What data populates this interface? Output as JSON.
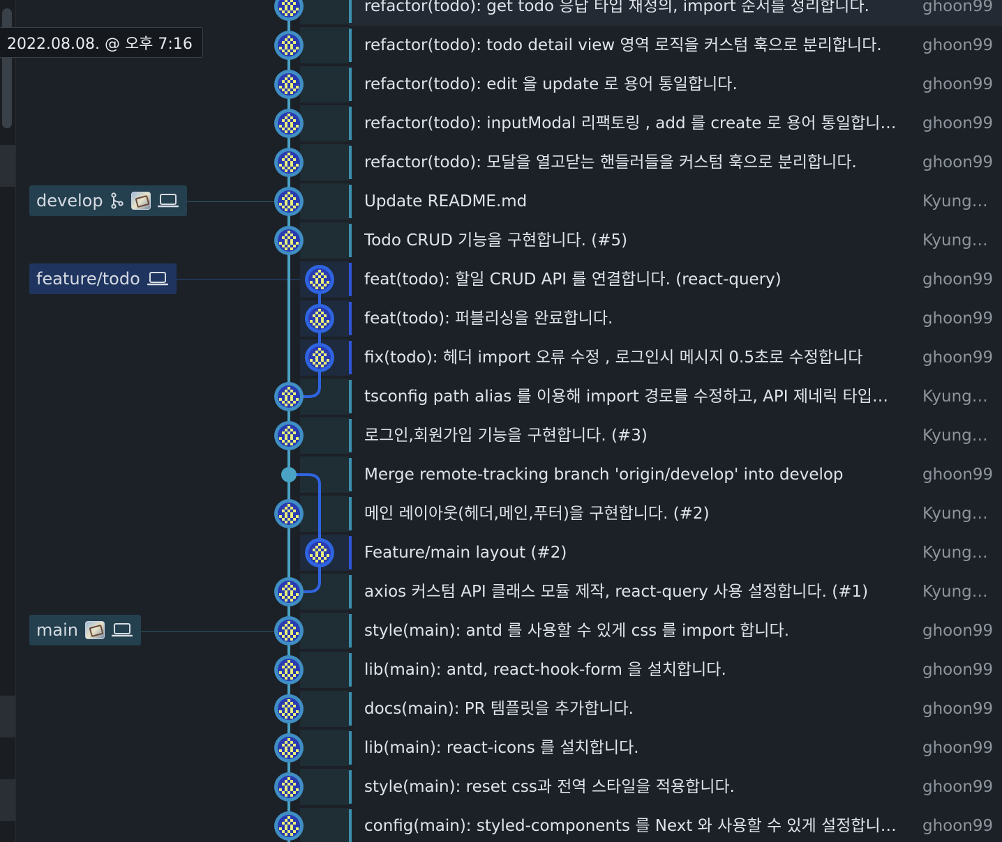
{
  "tooltip": {
    "timestamp": "2022.08.08. @ 오후 7:16"
  },
  "colors": {
    "background": "#1c2127",
    "lane_main": "#4aa3c4",
    "lane_feature": "#2f64e0",
    "tag_develop_bg": "#24404f",
    "tag_feature_bg": "#1f3560",
    "tag_main_bg": "#24404f",
    "selected_row_bg": "#232a33",
    "row_marker_develop": "#3d8fae",
    "row_marker_feature": "#2f55d6"
  },
  "refs": [
    {
      "name": "develop",
      "icons": [
        "branch-icon",
        "avatar-icon",
        "laptop-icon"
      ]
    },
    {
      "name": "feature/todo",
      "icons": [
        "laptop-icon"
      ]
    },
    {
      "name": "main",
      "icons": [
        "avatar-icon",
        "laptop-icon"
      ]
    }
  ],
  "commits": [
    {
      "message": "refactor(todo): get todo 응답 타입 재정의, import 순서를 정리합니다.",
      "author": "ghoon99",
      "lane": "develop"
    },
    {
      "message": "refactor(todo): todo detail view 영역 로직을 커스텀 훅으로 분리합니다.",
      "author": "ghoon99",
      "lane": "develop"
    },
    {
      "message": "refactor(todo): edit 을 update 로 용어 통일합니다.",
      "author": "ghoon99",
      "lane": "develop"
    },
    {
      "message": "refactor(todo): inputModal 리팩토링 , add 를 create 로 용어 통일합니다.",
      "author": "ghoon99",
      "lane": "develop"
    },
    {
      "message": "refactor(todo): 모달을 열고닫는 핸들러들을 커스텀 훅으로 분리합니다.",
      "author": "ghoon99",
      "lane": "develop"
    },
    {
      "message": "Update README.md",
      "author": "KyungH...",
      "lane": "develop"
    },
    {
      "message": "Todo CRUD 기능을 구현합니다. (#5)",
      "author": "KyungH...",
      "lane": "develop"
    },
    {
      "message": "feat(todo): 할일 CRUD API 를 연결합니다. (react-query)",
      "author": "ghoon99",
      "lane": "feature"
    },
    {
      "message": "feat(todo): 퍼블리싱을 완료합니다.",
      "author": "ghoon99",
      "lane": "feature"
    },
    {
      "message": "fix(todo): 헤더 import 오류 수정 , 로그인시 메시지 0.5초로 수정합니다",
      "author": "ghoon99",
      "lane": "feature"
    },
    {
      "message": "tsconfig path alias 를 이용해 import 경로를 수정하고, API 제네릭 타입변수...",
      "author": "KyungH...",
      "lane": "develop"
    },
    {
      "message": "로그인,회원가입 기능을 구현합니다. (#3)",
      "author": "KyungH...",
      "lane": "develop"
    },
    {
      "message": "Merge remote-tracking branch 'origin/develop' into develop",
      "author": "ghoon99",
      "lane": "merge"
    },
    {
      "message": "메인 레이아웃(헤더,메인,푸터)을 구현합니다. (#2)",
      "author": "KyungH...",
      "lane": "develop"
    },
    {
      "message": "Feature/main layout (#2)",
      "author": "KyungH...",
      "lane": "feature"
    },
    {
      "message": "axios 커스텀 API 클래스 모듈 제작, react-query 사용 설정합니다. (#1)",
      "author": "KyungH...",
      "lane": "develop"
    },
    {
      "message": "style(main): antd 를 사용할 수 있게 css 를 import 합니다.",
      "author": "ghoon99",
      "lane": "develop"
    },
    {
      "message": "lib(main): antd, react-hook-form 을 설치합니다.",
      "author": "ghoon99",
      "lane": "develop"
    },
    {
      "message": "docs(main): PR 템플릿을 추가합니다.",
      "author": "ghoon99",
      "lane": "develop"
    },
    {
      "message": "lib(main): react-icons 를 설치합니다.",
      "author": "ghoon99",
      "lane": "develop"
    },
    {
      "message": "style(main): reset css과 전역 스타일을 적용합니다.",
      "author": "ghoon99",
      "lane": "develop"
    },
    {
      "message": "config(main): styled-components 를 Next 와 사용할 수 있게 설정합니다.",
      "author": "ghoon99",
      "lane": "develop"
    }
  ]
}
